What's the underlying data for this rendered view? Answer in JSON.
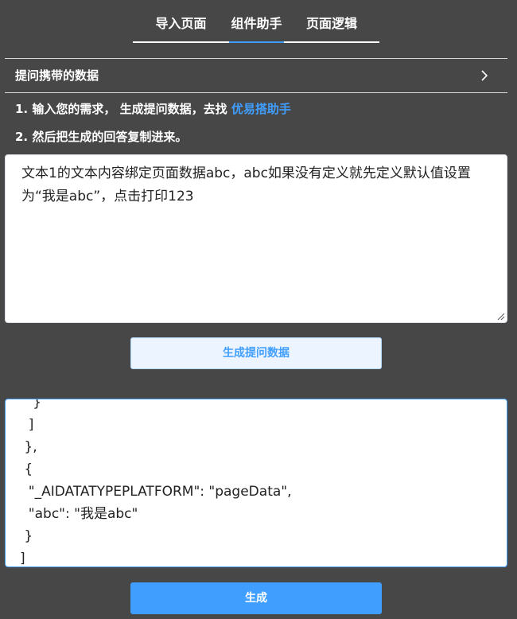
{
  "tabs": [
    {
      "label": "导入页面",
      "active": false
    },
    {
      "label": "组件助手",
      "active": true
    },
    {
      "label": "页面逻辑",
      "active": false
    }
  ],
  "section": {
    "title": "提问携带的数据",
    "chevron_icon": "chevron-right-icon"
  },
  "steps": {
    "step1_text": "1. 输入您的需求， 生成提问数据，去找",
    "step1_link": "优易搭助手",
    "step2_text": "2. 然后把生成的回答复制进来。"
  },
  "prompt": {
    "value": "文本1的文本内容绑定页面数据abc，abc如果没有定义就先定义默认值设置为“我是abc”，点击打印123"
  },
  "buttons": {
    "generate_prompt": "生成提问数据",
    "generate": "生成"
  },
  "answer": {
    "value": "   }\n  ]\n },\n {\n  \"_AIDATATYPEPLATFORM\": \"pageData\",\n  \"abc\": \"我是abc\"\n }\n]"
  },
  "colors": {
    "accent": "#409eff",
    "background": "#474747",
    "light_button_bg": "#ecf5ff"
  }
}
